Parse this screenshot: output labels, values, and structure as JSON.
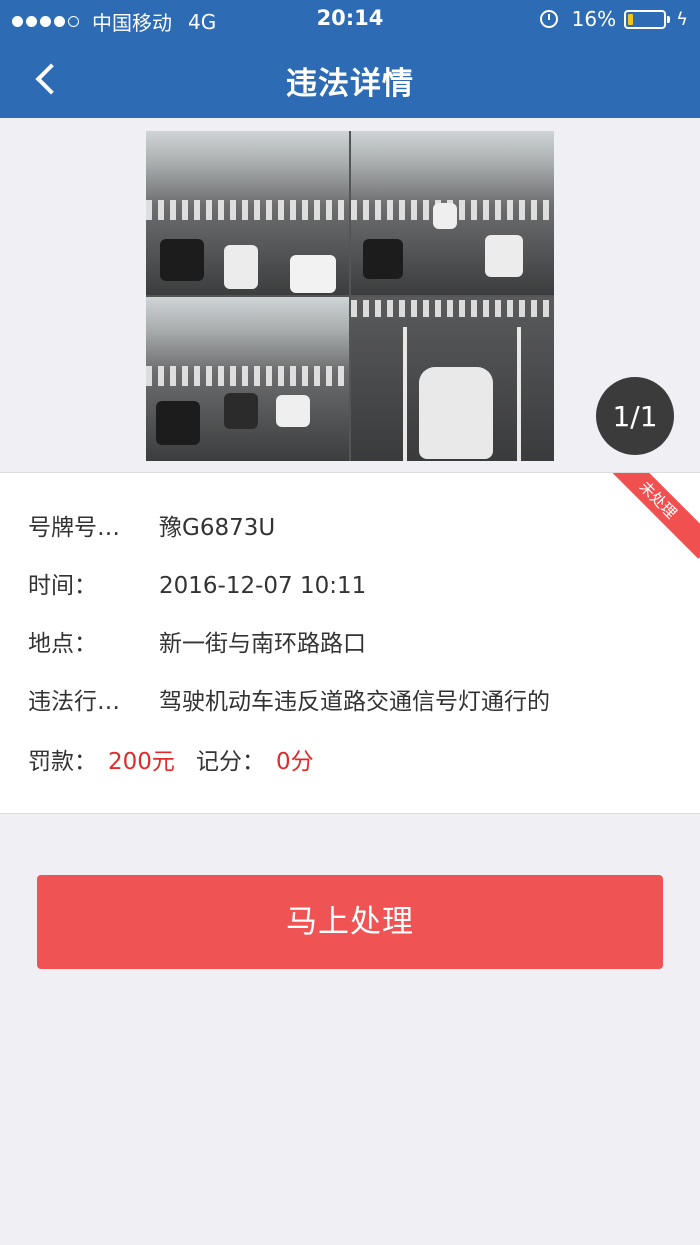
{
  "status_bar": {
    "signal_dots": [
      true,
      true,
      true,
      true,
      false
    ],
    "carrier": "中国移动",
    "network": "4G",
    "time": "20:14",
    "battery_percent": "16%",
    "battery_level": 0.16
  },
  "nav": {
    "title": "违法详情"
  },
  "photo": {
    "page_counter": "1/1"
  },
  "details": {
    "status_ribbon": "未处理",
    "rows": [
      {
        "label": "号牌号…",
        "value": "豫G6873U"
      },
      {
        "label": "时间：",
        "value": "2016-12-07 10:11"
      },
      {
        "label": "地点：",
        "value": "新一街与南环路路口"
      },
      {
        "label": "违法行…",
        "value": "驾驶机动车违反道路交通信号灯通行的"
      }
    ],
    "fine_label": "罚款：",
    "fine_value": "200元",
    "points_label": "记分：",
    "points_value": "0分"
  },
  "action_button": {
    "label": "马上处理"
  },
  "colors": {
    "header_blue": "#2d6bb5",
    "button_red": "#ef5353",
    "text_red": "#e22a2a",
    "background": "#efeff4"
  }
}
